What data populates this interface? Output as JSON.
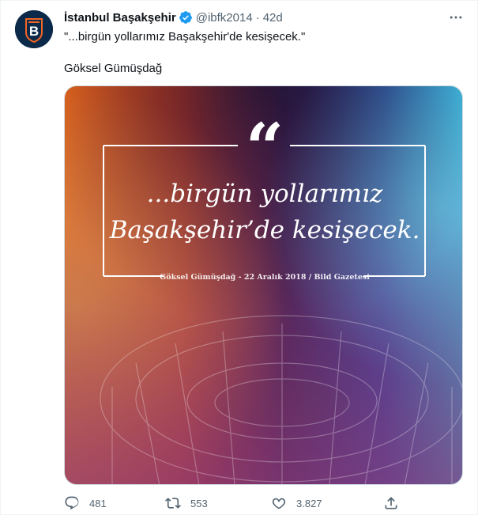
{
  "tweet": {
    "author": {
      "display_name": "İstanbul Başakşehir",
      "handle": "@ibfk2014",
      "verified_icon": "verified-badge-icon",
      "avatar_icon": "club-crest-icon"
    },
    "separator": "·",
    "time": "42d",
    "text_line1": "\"...birgün yollarımız Başakşehir'de kesişecek.\"",
    "text_line2": "Göksel Gümüşdağ",
    "media": {
      "quote_mark": "“",
      "quote_line1": "...birgün yollarımız",
      "quote_line2": "Başakşehir’de kesişecek.",
      "caption": "Göksel Gümüşdağ - 22 Aralık 2018 / Bild Gazetesi"
    },
    "actions": {
      "reply_count": "481",
      "retweet_count": "553",
      "like_count": "3.827",
      "reply_icon": "reply-icon",
      "retweet_icon": "retweet-icon",
      "like_icon": "heart-icon",
      "share_icon": "share-icon",
      "more_icon": "more-options-icon"
    }
  },
  "colors": {
    "text_primary": "#0f1419",
    "text_secondary": "#536471",
    "verified_blue": "#1d9bf0",
    "club_navy": "#0b2a4a",
    "club_orange": "#f26522"
  }
}
